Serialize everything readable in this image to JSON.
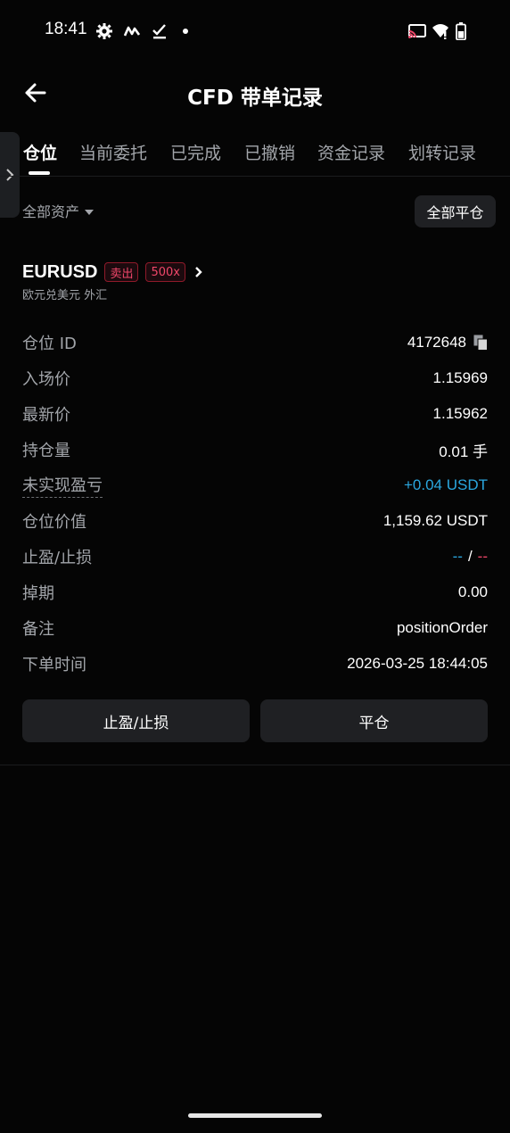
{
  "status_bar": {
    "time": "18:41",
    "left_icons": [
      "gear-icon",
      "activity-icon",
      "check-icon",
      "dot-icon"
    ],
    "right_icons": [
      "cast-icon",
      "wifi-icon",
      "battery-icon"
    ]
  },
  "header": {
    "title": "CFD 带单记录",
    "back_icon": "arrow-left-icon"
  },
  "tabs": [
    {
      "label": "仓位",
      "active": true
    },
    {
      "label": "当前委托",
      "active": false
    },
    {
      "label": "已完成",
      "active": false
    },
    {
      "label": "已撤销",
      "active": false
    },
    {
      "label": "资金记录",
      "active": false
    },
    {
      "label": "划转记录",
      "active": false
    }
  ],
  "filter": {
    "asset_label": "全部资产",
    "close_all_label": "全部平仓"
  },
  "position": {
    "symbol": "EURUSD",
    "side_badge": "卖出",
    "leverage_badge": "500x",
    "subtitle": "欧元兑美元 外汇",
    "rows": [
      {
        "label": "仓位 ID",
        "value": "4172648"
      },
      {
        "label": "入场价",
        "value": "1.15969"
      },
      {
        "label": "最新价",
        "value": "1.15962"
      },
      {
        "label": "持仓量",
        "value": "0.01 手"
      },
      {
        "label": "未实现盈亏",
        "value": "+0.04 USDT"
      },
      {
        "label": "仓位价值",
        "value": "1,159.62 USDT"
      },
      {
        "label": "止盈/止损",
        "tp": "--",
        "separator": "/",
        "sl": "--"
      },
      {
        "label": "掉期",
        "value": "0.00"
      },
      {
        "label": "备注",
        "value": "positionOrder"
      },
      {
        "label": "下单时间",
        "value": "2026-03-25 18:44:05"
      }
    ],
    "tp_sl_button": "止盈/止损",
    "close_button": "平仓"
  },
  "colors": {
    "background": "#050505",
    "panel": "#1f2023",
    "text_secondary": "#a2a5aa",
    "profit_blue": "#2ba8e0",
    "sell_red": "#f0476a"
  }
}
